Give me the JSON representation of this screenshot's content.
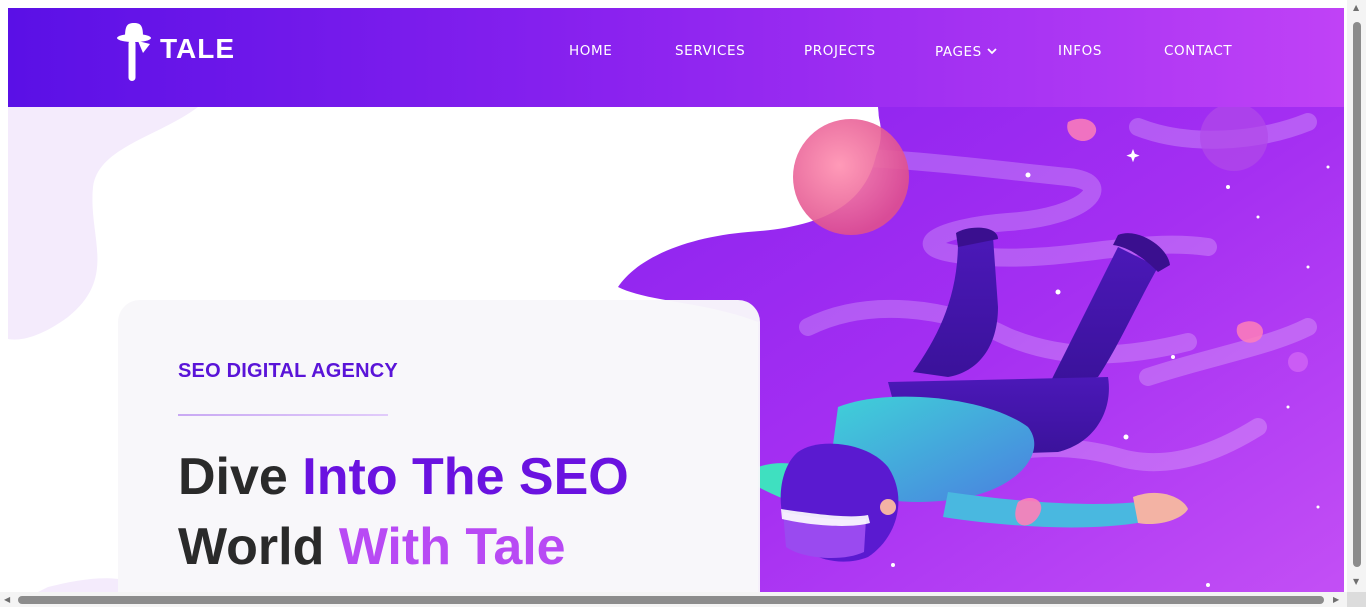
{
  "brand": {
    "name": "TALE",
    "colors": {
      "header_start": "#5a10e6",
      "header_end": "#c042f6",
      "accent_purple": "#6a12e0",
      "accent_pink": "#b84af4"
    }
  },
  "nav": {
    "items": [
      {
        "label": "HOME"
      },
      {
        "label": "SERVICES"
      },
      {
        "label": "PROJECTS"
      },
      {
        "label": "PAGES",
        "icon": "chevron-down-icon"
      },
      {
        "label": "INFOS"
      },
      {
        "label": "CONTACT"
      }
    ]
  },
  "hero": {
    "eyebrow": "SEO DIGITAL AGENCY",
    "headline": {
      "part1": "Dive ",
      "part2": "Into The SEO",
      "part3": "World ",
      "part4": "With Tale"
    },
    "illustration": "vr-diver-in-space-illustration"
  }
}
